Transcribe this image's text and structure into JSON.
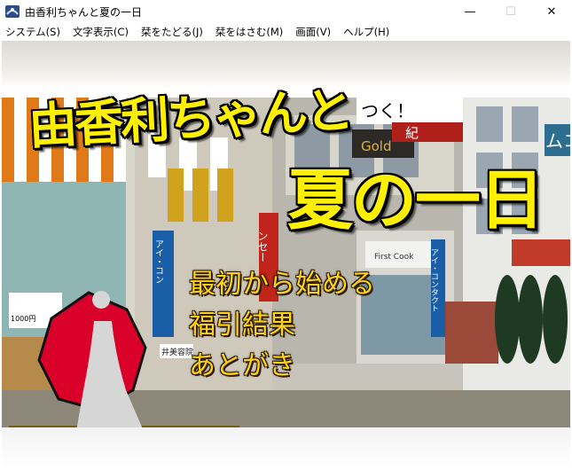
{
  "window": {
    "title": "由香利ちゃんと夏の一日",
    "minimize_glyph": "—",
    "maximize_glyph": "☐",
    "close_glyph": "✕"
  },
  "menubar": [
    {
      "label": "システム(S)"
    },
    {
      "label": "文字表示(C)"
    },
    {
      "label": "栞をたどる(J)"
    },
    {
      "label": "栞をはさむ(M)"
    },
    {
      "label": "画面(V)"
    },
    {
      "label": "ヘルプ(H)"
    }
  ],
  "logo": {
    "line1": "由香利ちゃんと",
    "line2": "夏の一日"
  },
  "title_menu": [
    {
      "label": "最初から始める"
    },
    {
      "label": "福引結果"
    },
    {
      "label": "あとがき"
    }
  ],
  "scene_signs": {
    "gold": "Gold",
    "first_cook": "First Cook",
    "ai_contact": "アイ・コンタクト",
    "ai_contact_short": "アイ・コン",
    "salon": "井美容院",
    "m_sign": "ムコ",
    "kanji_sign": "紀",
    "inseki": "ンセー",
    "price": "1000円",
    "tc": "つく！"
  },
  "colors": {
    "logo_yellow": "#ffef00",
    "choice_gold": "#ffd21a",
    "octagon_red": "#d9002a"
  }
}
